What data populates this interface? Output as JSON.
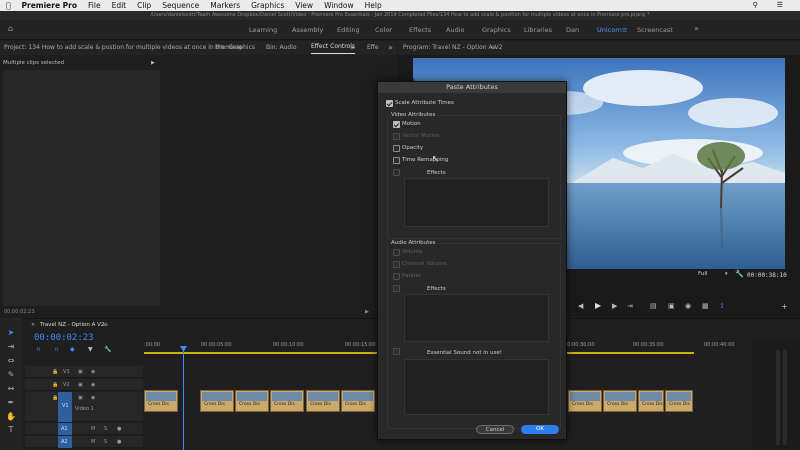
{
  "menubar": {
    "app": "Premiere Pro",
    "items": [
      "File",
      "Edit",
      "Clip",
      "Sequence",
      "Markers",
      "Graphics",
      "View",
      "Window",
      "Help"
    ]
  },
  "pathbar": {
    "text": "/Users/danielscott/Team Awesome Dropbox/Daniel Scott/Video - Premiere Pro Essentials - Jan 2019 Completed Files/134 How to add scale & position for multiple videos at once in Premiere pro.prproj *"
  },
  "workspaces": {
    "items": [
      "Learning",
      "Assembly",
      "Editing",
      "Color",
      "Effects",
      "Audio",
      "Graphics",
      "Libraries",
      "Dan",
      "Unicorn",
      "Screencast"
    ],
    "active": "Unicorn"
  },
  "panels": {
    "project": "Project: 134 How to add scale & postion for multiple videos at once in Premiere",
    "bin1": "Bin: Graphics",
    "bin2": "Bin: Audio",
    "effect_controls": "Effect Controls",
    "effect_more": "Effe",
    "program": "Program: Travel NZ - Option A V2"
  },
  "effect_controls": {
    "selection": "Multiple clips selected",
    "timecode": "00:00:02:23"
  },
  "program_monitor": {
    "zoom": "Full",
    "duration": "00:00:38:10"
  },
  "dialog": {
    "title": "Paste Attributes",
    "scale_attribute_times": "Scale Attribute Times",
    "video_attributes": "Video Attributes",
    "motion": "Motion",
    "vector_motion": "Vector Motion",
    "opacity": "Opacity",
    "time_remapping": "Time Remapping",
    "effects": "Effects",
    "audio_attributes": "Audio Attributes",
    "volume": "Volume",
    "channel_volume": "Channel Volume",
    "panner": "Panner",
    "audio_effects": "Effects",
    "essential_sound": "Essential Sound not in use!",
    "cancel": "Cancel",
    "ok": "OK"
  },
  "timeline": {
    "sequence": "Travel NZ - Option A V2",
    "timecode": "00:00:02:23",
    "ruler": [
      ":00:00",
      "00:00:05:00",
      "00:00:10:00",
      "00:00:15:00",
      "00:00:30:00",
      "00:00:35:00",
      "00:00:40:00"
    ],
    "tracks": {
      "v3": "V3",
      "v2": "V2",
      "v1": "V1",
      "video1": "Video 1",
      "a1": "A1",
      "a2": "A2"
    },
    "clip_label": "Cross Dis"
  },
  "colors": {
    "accent": "#3f8cff",
    "dialog_bg": "#282828"
  }
}
